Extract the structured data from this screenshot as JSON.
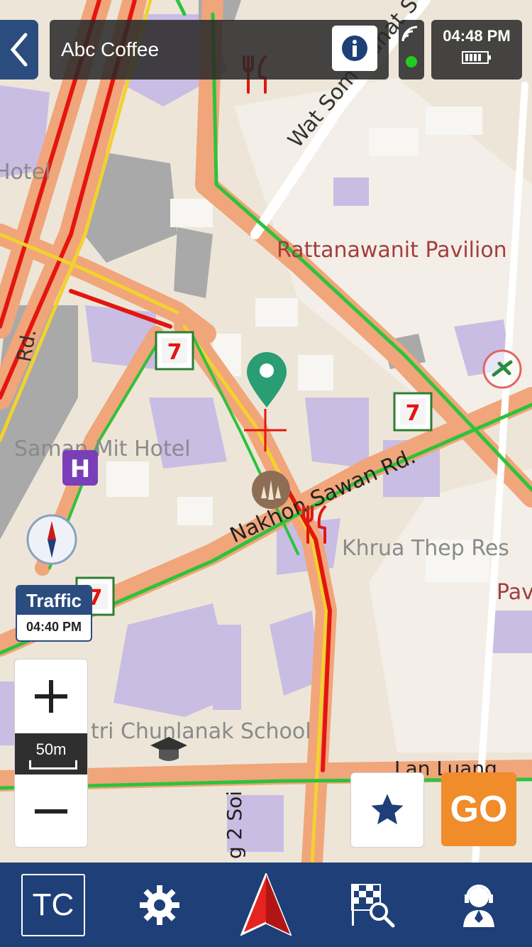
{
  "header": {
    "title": "Abc Coffee",
    "time": "04:48 PM",
    "gps_status_color": "#22cc22"
  },
  "traffic": {
    "label": "Traffic",
    "time": "04:40 PM"
  },
  "zoom": {
    "scale": "50m"
  },
  "actions": {
    "go_label": "GO"
  },
  "nav": {
    "tc_label": "TC"
  },
  "map": {
    "labels": {
      "hotel_left": "Hotel",
      "hotel_saman": "Saman Mit Hotel",
      "road_rd": "Rd.",
      "wat_som": "Wat Som Manat S",
      "pavilion": "Rattanawanit Pavilion",
      "nakhon": "Nakhon Sawan Rd.",
      "khrua": "Khrua Thep Res",
      "pav": "Pav",
      "school": "tri Chunlanak School",
      "lan_luang": "Lan Luang",
      "soi": "g 2 Soi"
    }
  },
  "colors": {
    "road_jam": "#e3160f",
    "road_slow": "#f2d130",
    "road_free": "#2cc33d",
    "road_base": "#f1a57a",
    "building": "#c9bde4",
    "accent": "#1e3f77",
    "go": "#f08c2a"
  }
}
